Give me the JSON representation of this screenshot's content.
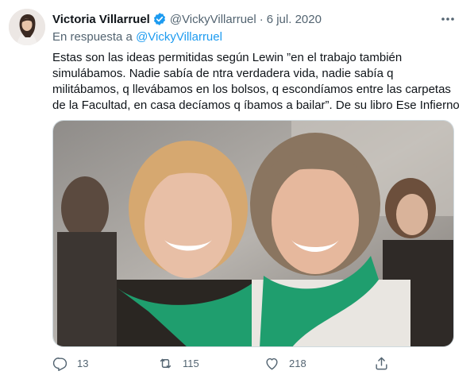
{
  "tweet": {
    "author_name": "Victoria Villarruel",
    "handle": "@VickyVillarruel",
    "separator": "·",
    "date": "6 jul. 2020",
    "reply_prefix": "En respuesta a",
    "reply_handle": "@VickyVillarruel",
    "text_lines": [
      "Estas son las ideas permitidas según Lewin ”en el trabajo también",
      "simulábamos. Nadie sabía de ntra verdadera vida, nadie sabía q",
      "militábamos, q llevábamos en los bolsos, q escondíamos entre las carpetas",
      "de la Facultad, en casa decíamos q íbamos a bailar”. De su libro Ese Infierno"
    ],
    "replies": "13",
    "retweets": "115",
    "likes": "218"
  },
  "icons": {
    "verified": "verified-badge-icon",
    "more": "more-options-icon",
    "reply": "reply-icon",
    "retweet": "retweet-icon",
    "like": "like-icon",
    "share": "share-icon"
  },
  "colors": {
    "accent": "#1d9bf0",
    "secondary_text": "#536471",
    "primary_text": "#0f1419",
    "scarf_green": "#1f9e6e"
  }
}
